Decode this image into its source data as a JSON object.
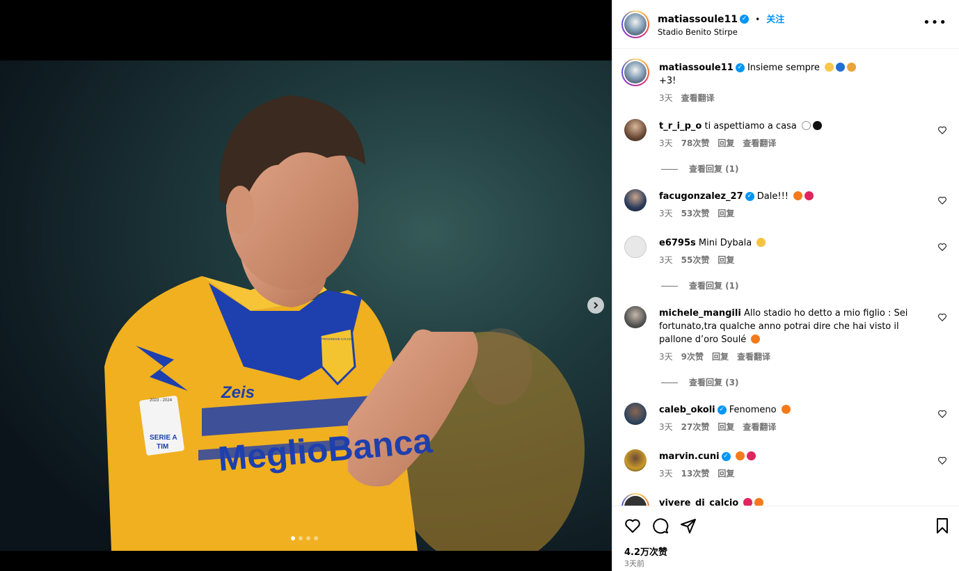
{
  "post": {
    "username": "matiassoule11",
    "follow_label": "关注",
    "separator": "•",
    "location": "Stadio Benito Stirpe",
    "caption_text": "Insieme sempre",
    "caption_line2": "+3!",
    "caption_time": "3天",
    "caption_translate": "查看翻译",
    "likes": "4.2万次赞",
    "time_ago": "3天前"
  },
  "media": {
    "jersey_sponsor": "MeglioBanca",
    "jersey_brand": "Zeis",
    "sleeve_patch": "SERIE A",
    "sleeve_patch_sub": "TIM",
    "crest_text": "FROSINONE CALCIO",
    "patch_year": "2023 - 2024",
    "carousel_count": 4,
    "carousel_active": 0
  },
  "comments": [
    {
      "user": "t_r_i_p_o",
      "text": "ti aspettiamo a casa",
      "verified": false,
      "time": "3天",
      "likes": "78次赞",
      "reply": "回复",
      "translate": "查看翻译",
      "view_replies": "查看回复 (1)"
    },
    {
      "user": "facugonzalez_27",
      "text": "Dale!!!",
      "verified": true,
      "time": "3天",
      "likes": "53次赞",
      "reply": "回复",
      "translate": "",
      "view_replies": ""
    },
    {
      "user": "e6795s",
      "text": "Mini Dybala",
      "verified": false,
      "time": "3天",
      "likes": "55次赞",
      "reply": "回复",
      "translate": "",
      "view_replies": "查看回复 (1)"
    },
    {
      "user": "michele_mangili",
      "text": "Allo stadio ho detto a mio figlio : Sei fortunato,tra qualche anno potrai dire che hai visto il pallone d’oro Soulé",
      "verified": false,
      "time": "3天",
      "likes": "9次赞",
      "reply": "回复",
      "translate": "查看翻译",
      "view_replies": "查看回复 (3)"
    },
    {
      "user": "caleb_okoli",
      "text": "Fenomeno",
      "verified": true,
      "time": "3天",
      "likes": "27次赞",
      "reply": "回复",
      "translate": "查看翻译",
      "view_replies": ""
    },
    {
      "user": "marvin.cuni",
      "text": "",
      "verified": true,
      "time": "3天",
      "likes": "13次赞",
      "reply": "回复",
      "translate": "",
      "view_replies": ""
    },
    {
      "user": "vivere_di_calcio",
      "text": "",
      "verified": false,
      "time": "",
      "likes": "",
      "reply": "",
      "translate": "",
      "view_replies": ""
    }
  ],
  "icons": {
    "like": "heart-icon",
    "comment": "comment-icon",
    "share": "send-icon",
    "save": "bookmark-icon",
    "more": "more-options-icon",
    "next": "chevron-right-icon"
  },
  "colors": {
    "accent": "#0095f6",
    "jersey_yellow": "#f2b21b",
    "jersey_blue": "#1d3ea8"
  }
}
